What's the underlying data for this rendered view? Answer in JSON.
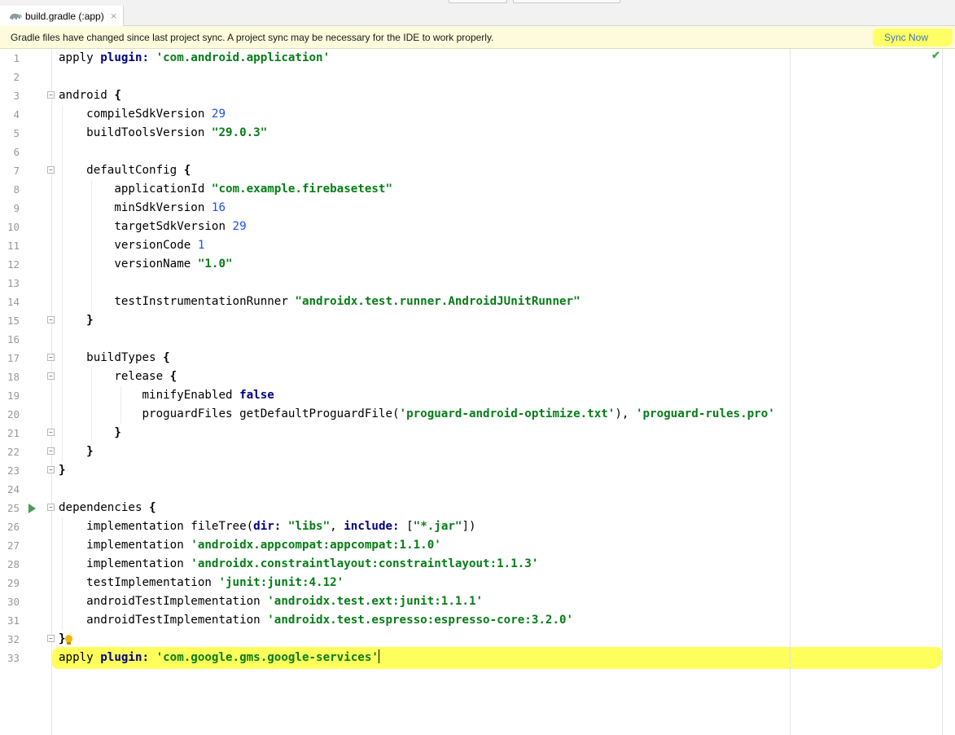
{
  "tab": {
    "label": "build.gradle (:app)",
    "close": "×"
  },
  "banner": {
    "message": "Gradle files have changed since last project sync. A project sync may be necessary for the IDE to work properly.",
    "action": "Sync Now"
  },
  "editor": {
    "status_icon": "check-icon",
    "lines": [
      {
        "n": "1",
        "parts": [
          [
            "t",
            "apply "
          ],
          [
            "k",
            "plugin: "
          ],
          [
            "s",
            "'com.android.application'"
          ]
        ]
      },
      {
        "n": "2",
        "parts": []
      },
      {
        "n": "3",
        "parts": [
          [
            "t",
            "android "
          ],
          [
            "b",
            "{"
          ]
        ],
        "fold": true
      },
      {
        "n": "4",
        "parts": [
          [
            "t",
            "    compileSdkVersion "
          ],
          [
            "n",
            "29"
          ]
        ]
      },
      {
        "n": "5",
        "parts": [
          [
            "t",
            "    buildToolsVersion "
          ],
          [
            "s",
            "\"29.0.3\""
          ]
        ]
      },
      {
        "n": "6",
        "parts": []
      },
      {
        "n": "7",
        "parts": [
          [
            "t",
            "    defaultConfig "
          ],
          [
            "b",
            "{"
          ]
        ],
        "fold": true
      },
      {
        "n": "8",
        "parts": [
          [
            "t",
            "        applicationId "
          ],
          [
            "s",
            "\"com.example.firebasetest\""
          ]
        ]
      },
      {
        "n": "9",
        "parts": [
          [
            "t",
            "        minSdkVersion "
          ],
          [
            "n",
            "16"
          ]
        ]
      },
      {
        "n": "10",
        "parts": [
          [
            "t",
            "        targetSdkVersion "
          ],
          [
            "n",
            "29"
          ]
        ]
      },
      {
        "n": "11",
        "parts": [
          [
            "t",
            "        versionCode "
          ],
          [
            "n",
            "1"
          ]
        ]
      },
      {
        "n": "12",
        "parts": [
          [
            "t",
            "        versionName "
          ],
          [
            "s",
            "\"1.0\""
          ]
        ]
      },
      {
        "n": "13",
        "parts": []
      },
      {
        "n": "14",
        "parts": [
          [
            "t",
            "        testInstrumentationRunner "
          ],
          [
            "s",
            "\"androidx.test.runner.AndroidJUnitRunner\""
          ]
        ]
      },
      {
        "n": "15",
        "parts": [
          [
            "t",
            "    "
          ],
          [
            "b",
            "}"
          ]
        ],
        "fold": true
      },
      {
        "n": "16",
        "parts": []
      },
      {
        "n": "17",
        "parts": [
          [
            "t",
            "    buildTypes "
          ],
          [
            "b",
            "{"
          ]
        ],
        "fold": true
      },
      {
        "n": "18",
        "parts": [
          [
            "t",
            "        release "
          ],
          [
            "b",
            "{"
          ]
        ],
        "fold": true
      },
      {
        "n": "19",
        "parts": [
          [
            "t",
            "            minifyEnabled "
          ],
          [
            "k",
            "false"
          ]
        ]
      },
      {
        "n": "20",
        "parts": [
          [
            "t",
            "            proguardFiles getDefaultProguardFile("
          ],
          [
            "s",
            "'proguard-android-optimize.txt'"
          ],
          [
            "t",
            "), "
          ],
          [
            "s",
            "'proguard-rules.pro'"
          ]
        ]
      },
      {
        "n": "21",
        "parts": [
          [
            "t",
            "        "
          ],
          [
            "b",
            "}"
          ]
        ],
        "fold": true
      },
      {
        "n": "22",
        "parts": [
          [
            "t",
            "    "
          ],
          [
            "b",
            "}"
          ]
        ],
        "fold": true
      },
      {
        "n": "23",
        "parts": [
          [
            "b",
            "}"
          ]
        ],
        "fold": true
      },
      {
        "n": "24",
        "parts": []
      },
      {
        "n": "25",
        "parts": [
          [
            "t",
            "dependencies "
          ],
          [
            "b",
            "{"
          ]
        ],
        "fold": true,
        "run": true
      },
      {
        "n": "26",
        "parts": [
          [
            "t",
            "    implementation fileTree("
          ],
          [
            "k",
            "dir: "
          ],
          [
            "s",
            "\"libs\""
          ],
          [
            "t",
            ", "
          ],
          [
            "k",
            "include: "
          ],
          [
            "t",
            "["
          ],
          [
            "s",
            "\"*.jar\""
          ],
          [
            "t",
            "])"
          ]
        ]
      },
      {
        "n": "27",
        "parts": [
          [
            "t",
            "    implementation "
          ],
          [
            "s",
            "'androidx.appcompat:appcompat:1.1.0'"
          ]
        ]
      },
      {
        "n": "28",
        "parts": [
          [
            "t",
            "    implementation "
          ],
          [
            "s",
            "'androidx.constraintlayout:constraintlayout:1.1.3'"
          ]
        ]
      },
      {
        "n": "29",
        "parts": [
          [
            "t",
            "    testImplementation "
          ],
          [
            "s",
            "'junit:junit:4.12'"
          ]
        ]
      },
      {
        "n": "30",
        "parts": [
          [
            "t",
            "    androidTestImplementation "
          ],
          [
            "s",
            "'androidx.test.ext:junit:1.1.1'"
          ]
        ]
      },
      {
        "n": "31",
        "parts": [
          [
            "t",
            "    androidTestImplementation "
          ],
          [
            "s",
            "'androidx.test.espresso:espresso-core:3.2.0'"
          ]
        ]
      },
      {
        "n": "32",
        "parts": [
          [
            "b",
            "}"
          ]
        ],
        "fold": true,
        "bulb": true
      },
      {
        "n": "33",
        "parts": [
          [
            "t",
            "apply "
          ],
          [
            "k",
            "plugin: "
          ],
          [
            "s",
            "'com.google.gms.google-services'"
          ]
        ],
        "current": true
      }
    ]
  },
  "colors": {
    "keyword": "#000080",
    "string": "#067d17",
    "number": "#1750eb",
    "highlighter": "#ffff5c",
    "banner_bg": "#fdfbdc",
    "link": "#3a78c4"
  }
}
